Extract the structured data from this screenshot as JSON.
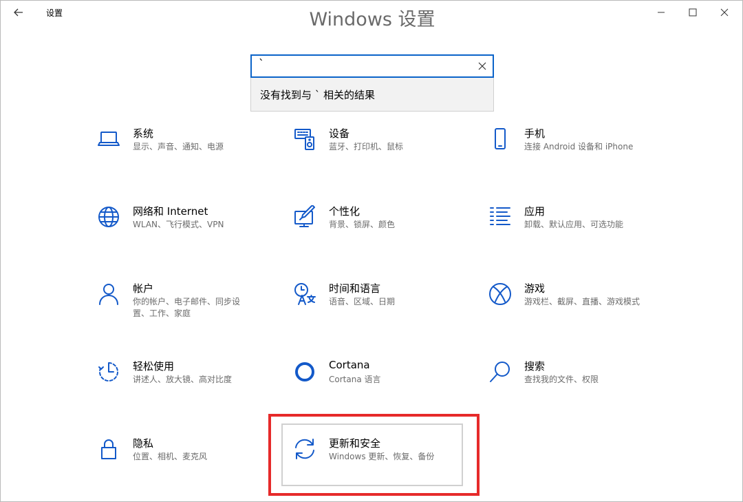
{
  "window": {
    "title": "设置",
    "heading": "Windows 设置",
    "back_icon": "arrow-left-icon",
    "minimize_icon": "minimize-icon",
    "maximize_icon": "maximize-icon",
    "close_icon": "close-icon"
  },
  "search": {
    "value": "`",
    "no_result": "没有找到与 ` 相关的结果",
    "clear_icon": "clear-x-icon",
    "accent": "#0a63c9"
  },
  "tiles": [
    {
      "title": "系统",
      "desc": "显示、声音、通知、电源",
      "icon": "laptop-icon"
    },
    {
      "title": "设备",
      "desc": "蓝牙、打印机、鼠标",
      "icon": "devices-icon"
    },
    {
      "title": "手机",
      "desc": "连接 Android 设备和 iPhone",
      "icon": "phone-icon"
    },
    {
      "title": "网络和 Internet",
      "desc": "WLAN、飞行模式、VPN",
      "icon": "globe-icon"
    },
    {
      "title": "个性化",
      "desc": "背景、锁屏、颜色",
      "icon": "paint-icon"
    },
    {
      "title": "应用",
      "desc": "卸载、默认应用、可选功能",
      "icon": "apps-list-icon"
    },
    {
      "title": "帐户",
      "desc": "你的帐户、电子邮件、同步设置、工作、家庭",
      "icon": "person-icon"
    },
    {
      "title": "时间和语言",
      "desc": "语音、区域、日期",
      "icon": "time-language-icon"
    },
    {
      "title": "游戏",
      "desc": "游戏栏、截屏、直播、游戏模式",
      "icon": "xbox-icon"
    },
    {
      "title": "轻松使用",
      "desc": "讲述人、放大镜、高对比度",
      "icon": "ease-of-access-icon"
    },
    {
      "title": "Cortana",
      "desc": "Cortana 语言",
      "icon": "cortana-icon"
    },
    {
      "title": "搜索",
      "desc": "查找我的文件、权限",
      "icon": "search-icon"
    },
    {
      "title": "隐私",
      "desc": "位置、相机、麦克风",
      "icon": "lock-icon"
    },
    {
      "title": "更新和安全",
      "desc": "Windows 更新、恢复、备份",
      "icon": "sync-icon"
    }
  ],
  "colors": {
    "icon": "#1359c9",
    "highlight": "#e62a2a"
  }
}
